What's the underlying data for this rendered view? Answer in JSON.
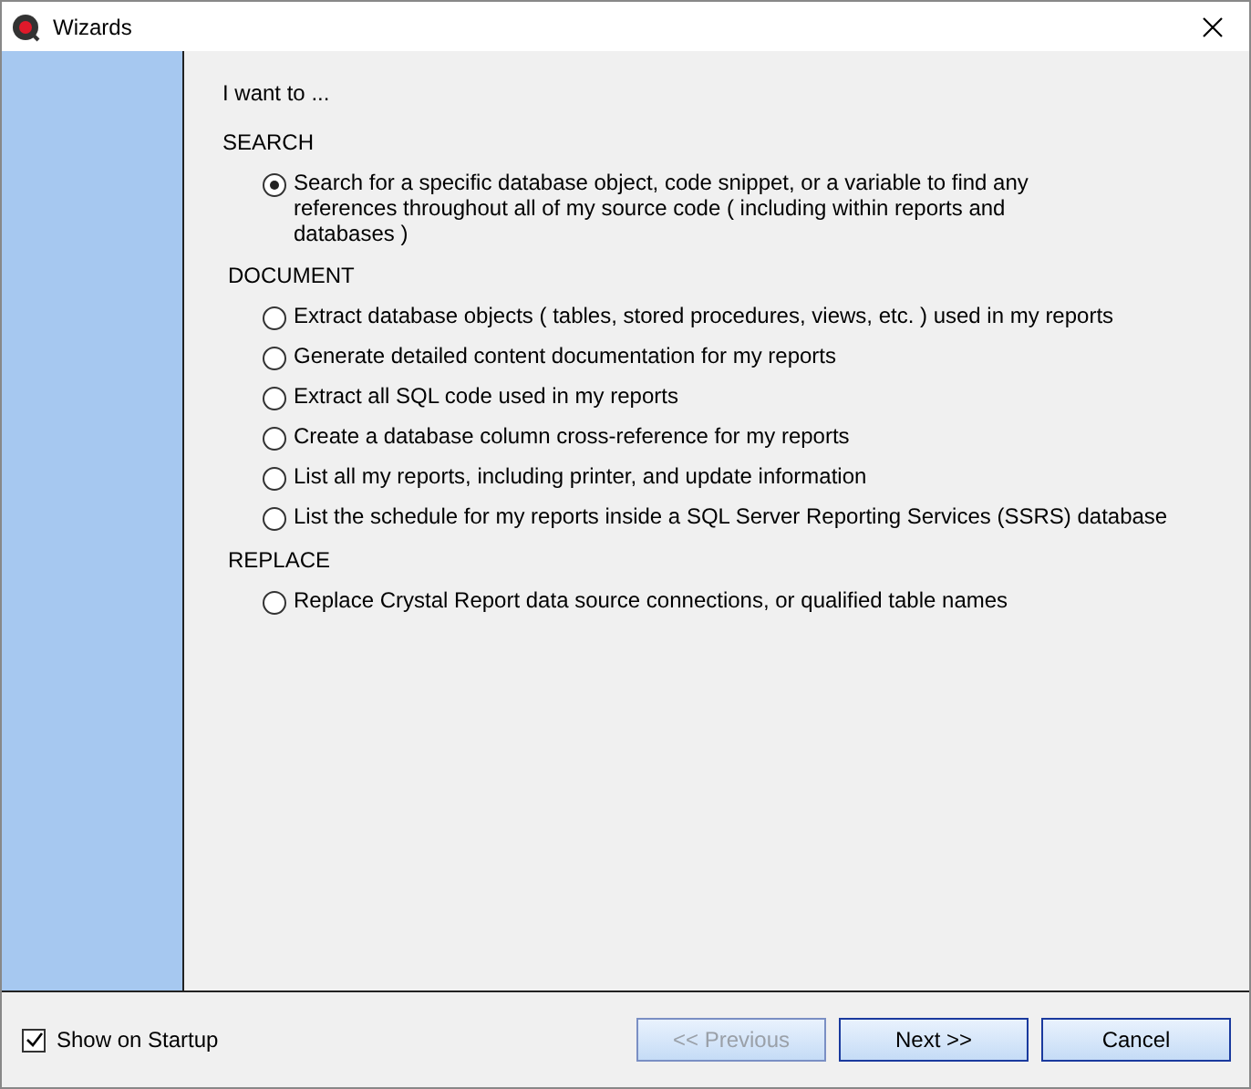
{
  "window": {
    "title": "Wizards"
  },
  "prompt": "I want to ...",
  "sections": [
    {
      "heading": "SEARCH",
      "options": [
        {
          "label": "Search for a specific database object, code snippet, or a variable to find any references throughout all of my source code ( including within reports and databases )",
          "selected": true
        }
      ]
    },
    {
      "heading": "DOCUMENT",
      "options": [
        {
          "label": "Extract database objects ( tables, stored procedures, views, etc. ) used in my reports",
          "selected": false
        },
        {
          "label": "Generate detailed content documentation for my reports",
          "selected": false
        },
        {
          "label": "Extract all SQL code used in my reports",
          "selected": false
        },
        {
          "label": "Create a database column cross-reference for my reports",
          "selected": false
        },
        {
          "label": "List all my reports, including printer, and update information",
          "selected": false
        },
        {
          "label": "List the schedule for my reports inside a SQL Server Reporting Services (SSRS) database",
          "selected": false
        }
      ]
    },
    {
      "heading": "REPLACE",
      "options": [
        {
          "label": "Replace Crystal Report data source connections, or qualified table names",
          "selected": false
        }
      ]
    }
  ],
  "startup_checkbox": {
    "label": "Show on Startup",
    "checked": true
  },
  "buttons": [
    {
      "label": "<< Previous",
      "disabled": true
    },
    {
      "label": "Next >>",
      "disabled": false
    },
    {
      "label": "Cancel",
      "disabled": false
    }
  ]
}
